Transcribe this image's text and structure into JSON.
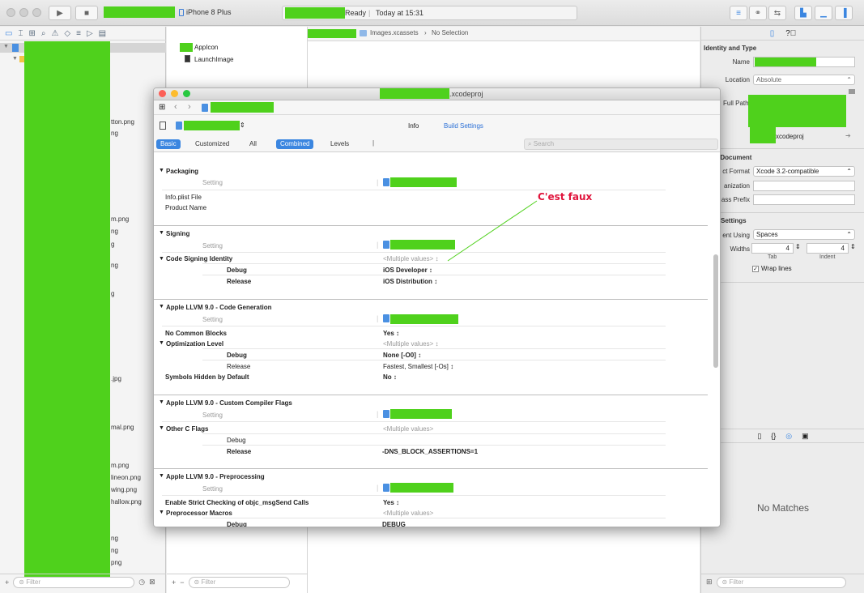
{
  "toolbar": {
    "device": "iPhone 8 Plus",
    "status_ready": "Ready",
    "status_time": "Today at 15:31"
  },
  "navigator": {
    "files": [
      "tton.png",
      "ng",
      "m.png",
      "ng",
      "g",
      "ng",
      "g",
      ".jpg",
      "mal.png",
      "m.png",
      "lineon.png",
      "wing.png",
      "hallow.png",
      "ng",
      "ng",
      "png"
    ],
    "filter_placeholder": "Filter"
  },
  "assets": {
    "items": [
      "AppIcon",
      "LaunchImage"
    ],
    "filter_placeholder": "Filter"
  },
  "jumpbar": {
    "catalog": "Images.xcassets",
    "selection": "No Selection"
  },
  "inspector": {
    "identity_title": "Identity and Type",
    "name_label": "Name",
    "location_label": "Location",
    "location_value": "Absolute",
    "fullpath_label": "Full Path",
    "fullpath_tail": "xcodeproj",
    "project_document_title": "ct Document",
    "project_format_label": "ct Format",
    "project_format_value": "Xcode 3.2-compatible",
    "organization_label": "anization",
    "class_prefix_label": "ass Prefix",
    "text_settings_title": "Settings",
    "indent_using_label": "ent Using",
    "indent_using_value": "Spaces",
    "widths_label": "Widths",
    "tab_value": "4",
    "indent_value": "4",
    "tab_label": "Tab",
    "indent_label": "Indent",
    "wrap_lines_label": "Wrap lines",
    "no_matches": "No Matches",
    "filter_placeholder": "Filter"
  },
  "project_window": {
    "title_suffix": ".xcodeproj",
    "tab_info": "Info",
    "tab_build_settings": "Build Settings",
    "filter_basic": "Basic",
    "filter_customized": "Customized",
    "filter_all": "All",
    "filter_combined": "Combined",
    "filter_levels": "Levels",
    "search_placeholder": "Search",
    "setting_header": "Setting",
    "sections": {
      "packaging": {
        "title": "Packaging",
        "rows": [
          "Info.plist File",
          "Product Name"
        ]
      },
      "signing": {
        "title": "Signing",
        "identity_label": "Code Signing Identity",
        "identity_value": "<Multiple values> ↕",
        "debug_label": "Debug",
        "debug_value": "iOS Developer ↕",
        "release_label": "Release",
        "release_value": "iOS Distribution ↕"
      },
      "codegen": {
        "title": "Apple LLVM 9.0 - Code Generation",
        "no_common_label": "No Common Blocks",
        "no_common_value": "Yes ↕",
        "opt_label": "Optimization Level",
        "opt_value": "<Multiple values> ↕",
        "opt_debug_label": "Debug",
        "opt_debug_value": "None [-O0] ↕",
        "opt_release_label": "Release",
        "opt_release_value": "Fastest, Smallest [-Os] ↕",
        "symbols_label": "Symbols Hidden by Default",
        "symbols_value": "No ↕"
      },
      "compiler_flags": {
        "title": "Apple LLVM 9.0 - Custom Compiler Flags",
        "other_c_label": "Other C Flags",
        "other_c_value": "<Multiple values>",
        "debug_label": "Debug",
        "release_label": "Release",
        "release_value": "-DNS_BLOCK_ASSERTIONS=1"
      },
      "preprocessing": {
        "title": "Apple LLVM 9.0 - Preprocessing",
        "strict_label": "Enable Strict Checking of objc_msgSend Calls",
        "strict_value": "Yes ↕",
        "macros_label": "Preprocessor Macros",
        "macros_value": "<Multiple values>",
        "macros_debug_label": "Debug",
        "macros_debug_value": "DEBUG"
      }
    }
  },
  "annotation": {
    "text": "C'est faux",
    "color": "#e0143c",
    "line_color": "#4fd11c"
  }
}
